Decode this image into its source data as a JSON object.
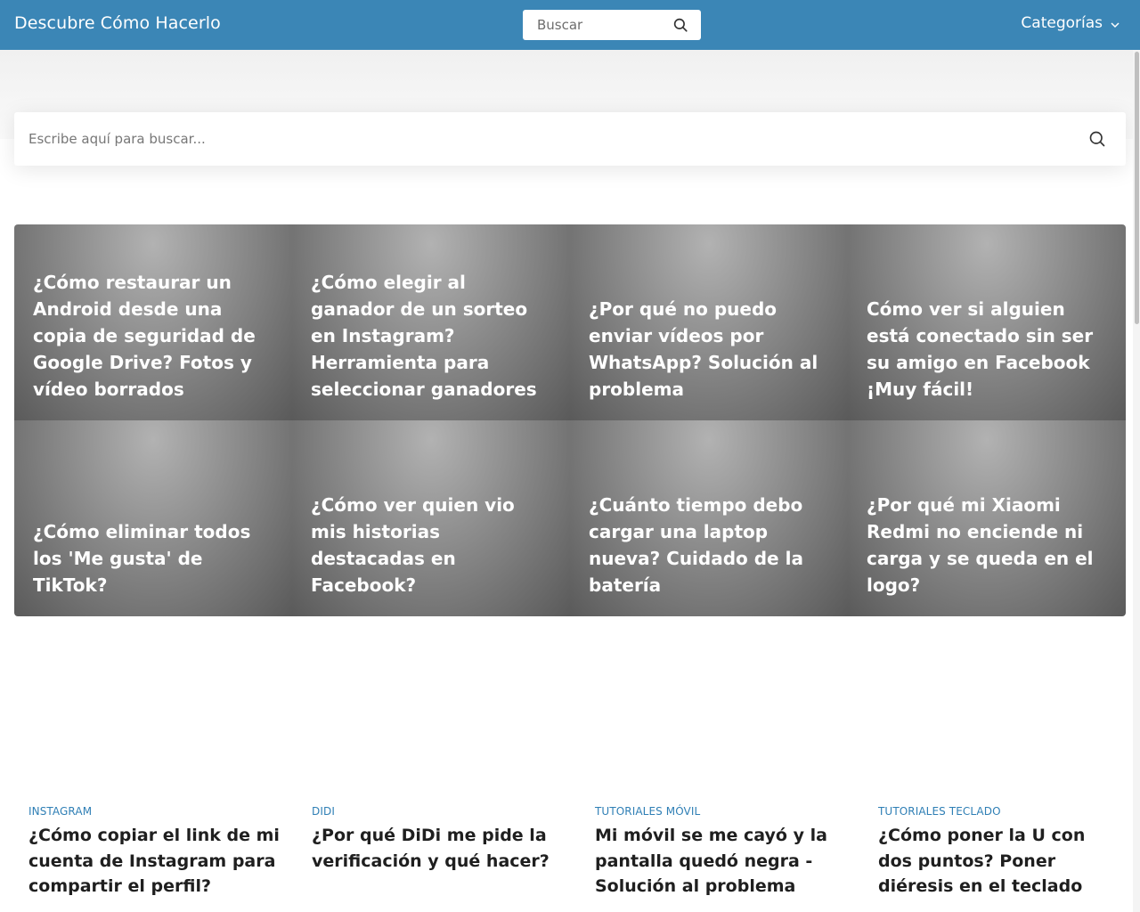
{
  "header": {
    "site_title": "Descubre Cómo Hacerlo",
    "search_placeholder": "Buscar",
    "categories_label": "Categorías",
    "color": "#3b86b6"
  },
  "main_search": {
    "placeholder": "Escribe aquí para buscar..."
  },
  "featured": [
    {
      "title": "¿Cómo restaurar un Android desde una copia de seguridad de Google Drive? Fotos y vídeo borrados"
    },
    {
      "title": "¿Cómo elegir al ganador de un sorteo en Instagram? Herramienta para seleccionar ganadores"
    },
    {
      "title": "¿Por qué no puedo enviar vídeos por WhatsApp? Solución al problema"
    },
    {
      "title": "Cómo ver si alguien está conectado sin ser su amigo en Facebook ¡Muy fácil!"
    },
    {
      "title": "¿Cómo eliminar todos los 'Me gusta' de TikTok?"
    },
    {
      "title": "¿Cómo ver quien vio mis historias destacadas en Facebook?"
    },
    {
      "title": "¿Cuánto tiempo debo cargar una laptop nueva? Cuidado de la batería"
    },
    {
      "title": "¿Por qué mi Xiaomi Redmi no enciende ni carga y se queda en el logo?"
    }
  ],
  "articles": [
    {
      "category": "INSTAGRAM",
      "title": "¿Cómo copiar el link de mi cuenta de Instagram para compartir el perfil?"
    },
    {
      "category": "DIDI",
      "title": "¿Por qué DiDi me pide la verificación y qué hacer?"
    },
    {
      "category": "TUTORIALES MÓVIL",
      "title": "Mi móvil se me cayó y la pantalla quedó negra - Solución al problema"
    },
    {
      "category": "TUTORIALES TECLADO",
      "title": "¿Cómo poner la U con dos puntos? Poner diéresis en el teclado"
    }
  ],
  "icons": {
    "search": "search-icon",
    "chevron": "chevron-down-icon"
  }
}
